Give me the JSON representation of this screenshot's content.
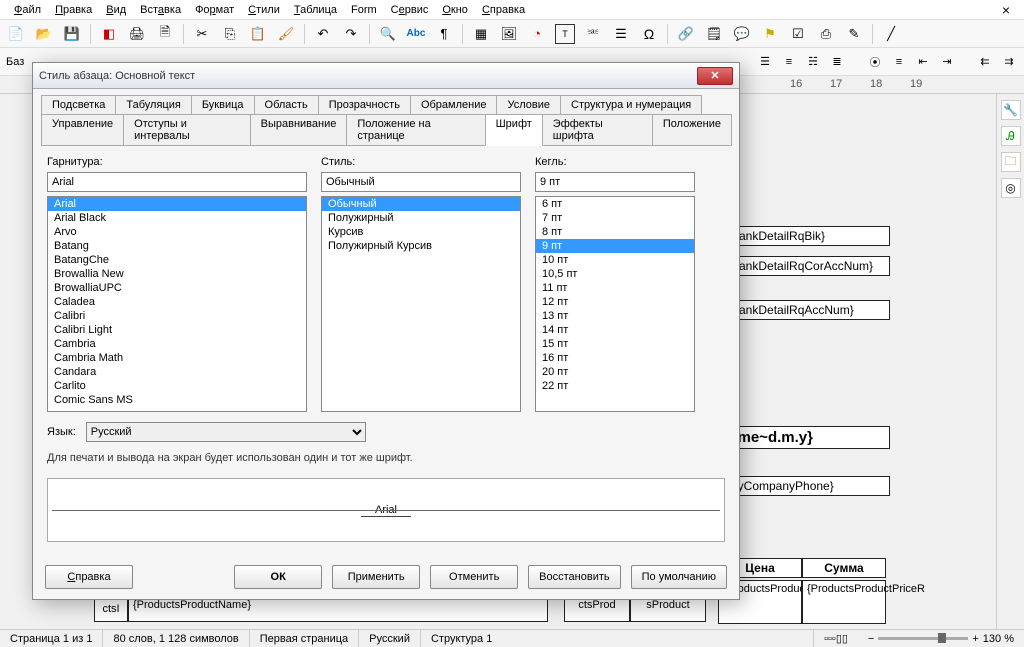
{
  "menu": {
    "file": "Файл",
    "edit": "Правка",
    "view": "Вид",
    "insert": "Вставка",
    "format": "Формат",
    "styles": "Стили",
    "table": "Таблица",
    "form": "Form",
    "tools": "Сервис",
    "window": "Окно",
    "help": "Справка"
  },
  "ruler_ticks": [
    "16",
    "17",
    "18",
    "19"
  ],
  "sidebar_label": "Баз",
  "dialog": {
    "title": "Стиль абзаца: Основной текст",
    "tabs_row1": [
      "Подсветка",
      "Табуляция",
      "Буквица",
      "Область",
      "Прозрачность",
      "Обрамление",
      "Условие",
      "Структура и нумерация"
    ],
    "tabs_row2": [
      "Управление",
      "Отступы и интервалы",
      "Выравнивание",
      "Положение на странице",
      "Шрифт",
      "Эффекты шрифта",
      "Положение"
    ],
    "active_tab": "Шрифт",
    "family_label": "Гарнитура:",
    "style_label": "Стиль:",
    "size_label": "Кегль:",
    "family_value": "Arial",
    "family_list": [
      "Arial",
      "Arial Black",
      "Arvo",
      "Batang",
      "BatangChe",
      "Browallia New",
      "BrowalliaUPC",
      "Caladea",
      "Calibri",
      "Calibri Light",
      "Cambria",
      "Cambria Math",
      "Candara",
      "Carlito",
      "Comic Sans MS"
    ],
    "style_value": "Обычный",
    "style_list": [
      "Обычный",
      "Полужирный",
      "Курсив",
      "Полужирный Курсив"
    ],
    "size_value": "9 пт",
    "size_list": [
      "6 пт",
      "7 пт",
      "8 пт",
      "9 пт",
      "10 пт",
      "10,5 пт",
      "11 пт",
      "12 пт",
      "13 пт",
      "14 пт",
      "15 пт",
      "16 пт",
      "20 пт",
      "22 пт"
    ],
    "lang_label": "Язык:",
    "lang_value": "Русский",
    "info": "Для печати и вывода на экран будет использован один и тот же шрифт.",
    "preview_name": "Arial",
    "btn_help": "Справка",
    "btn_ok": "ОК",
    "btn_apply": "Применить",
    "btn_cancel": "Отменить",
    "btn_reset": "Восстановить",
    "btn_default": "По умолчанию"
  },
  "doc_fragments": {
    "f1": "{...ankDetailRqBik}",
    "f2": "{...ankDetailRqCorAccNum}",
    "f3": "{...ankDetailRqAccNum}",
    "f4": "...me~d.m.y}",
    "f5": "...lyCompanyPhone}",
    "h1": "Цена",
    "h2": "Сумма",
    "c1": "{ProductsProductPriceRa",
    "c2": "{ProductsProductPriceR",
    "l1": "odu",
    "l2": "ctsI",
    "l3": "{ProductsProductName}",
    "l4": "ctsProd",
    "l5": "sProduct"
  },
  "status": {
    "page": "Страница 1 из 1",
    "words": "80 слов, 1 128 символов",
    "pstyle": "Первая страница",
    "lang": "Русский",
    "outline": "Структура 1",
    "zoom": "130 %"
  }
}
